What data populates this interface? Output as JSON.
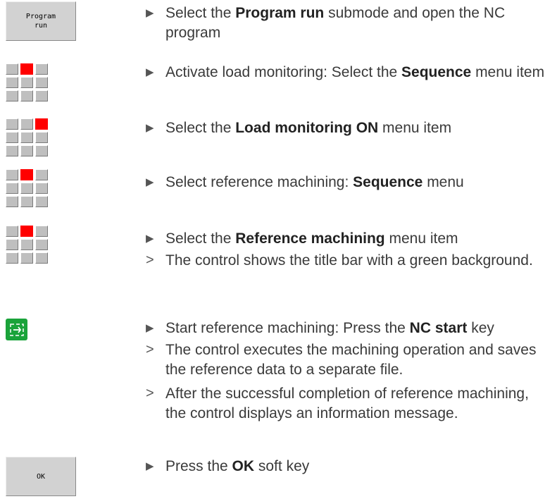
{
  "softkeys": {
    "program_run": "Program\nrun",
    "ok": "OK"
  },
  "markers": {
    "step": "▶",
    "result": ">"
  },
  "steps": [
    {
      "pre": "Select the ",
      "bold": "Program run",
      "post": " submode and open the NC program"
    },
    {
      "pre": "Activate load monitoring: Select the ",
      "bold": "Sequence",
      "post": " menu item"
    },
    {
      "pre": "Select the ",
      "bold": "Load monitoring ON",
      "post": " menu item"
    },
    {
      "pre": "Select reference machining: ",
      "bold": "Sequence",
      "post": " menu"
    },
    {
      "pre": "Select the ",
      "bold": "Reference machining",
      "post": " menu item"
    },
    {
      "text": "The control shows the title bar with a green background."
    },
    {
      "pre": "Start reference machining: Press the ",
      "bold": "NC start",
      "post": " key"
    },
    {
      "text": "The control executes the machining operation and saves the reference data to a separate file."
    },
    {
      "text": "After the successful completion of reference machining, the control displays an information message."
    },
    {
      "pre": "Press the ",
      "bold": "OK",
      "post": " soft key"
    }
  ],
  "colors": {
    "menu_active": "#ff0000",
    "nc_start": "#1aa33a"
  }
}
